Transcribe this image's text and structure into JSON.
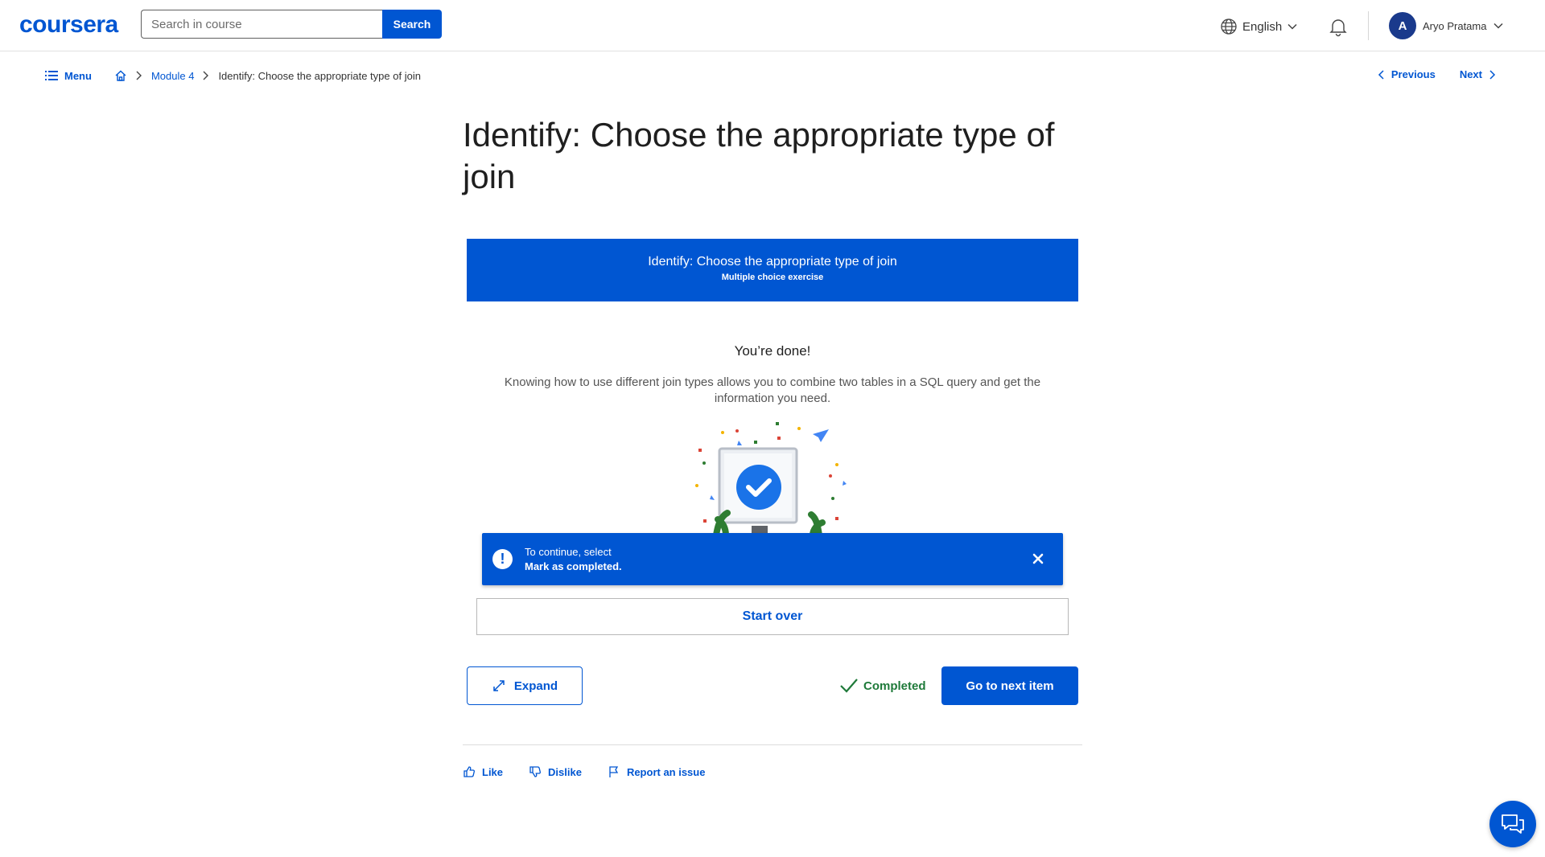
{
  "header": {
    "logo": "coursera",
    "search_placeholder": "Search in course",
    "search_button": "Search",
    "language": "English",
    "user_initial": "A",
    "user_name": "Aryo Pratama"
  },
  "breadcrumb": {
    "menu_label": "Menu",
    "module": "Module 4",
    "current": "Identify: Choose the appropriate type of join"
  },
  "nav": {
    "previous": "Previous",
    "next": "Next"
  },
  "main": {
    "title": "Identify: Choose the appropriate type of join",
    "banner_title": "Identify: Choose the appropriate type of join",
    "banner_subtitle": "Multiple choice exercise",
    "done_title": "You’re done!",
    "done_text": "Knowing how to use different join types allows you to combine two tables in a SQL query and get the information you need."
  },
  "toast": {
    "line1": "To continue, select",
    "line2": "Mark as completed."
  },
  "actions": {
    "start_over": "Start over",
    "expand": "Expand",
    "completed": "Completed",
    "next_item": "Go to next item"
  },
  "feedback": {
    "like": "Like",
    "dislike": "Dislike",
    "report": "Report an issue"
  },
  "colors": {
    "brand": "#0056d2",
    "success": "#1f7a3a"
  }
}
